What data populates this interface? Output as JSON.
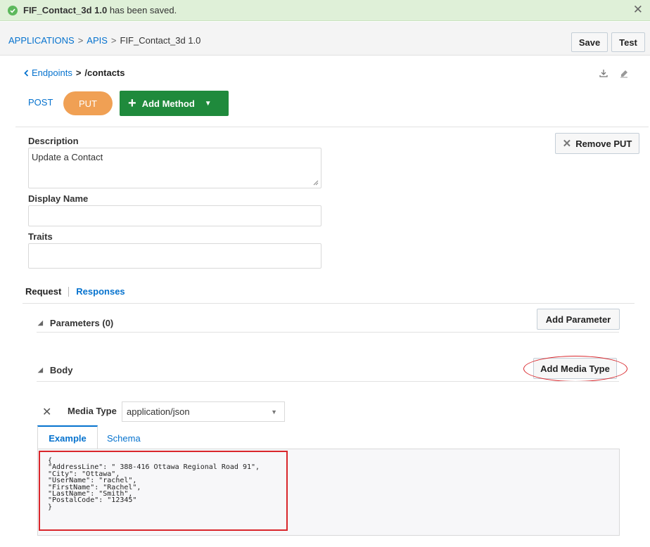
{
  "banner": {
    "name_bold": "FIF_Contact_3d 1.0",
    "message": " has been saved.",
    "close_glyph": "✕"
  },
  "breadcrumb": {
    "items": [
      "APPLICATIONS",
      ">",
      "APIS",
      ">",
      "FIF_Contact_3d  1.0"
    ]
  },
  "toolbar": {
    "save_label": "Save",
    "test_label": "Test"
  },
  "endpoint_nav": {
    "back_label": "Endpoints",
    "separator": ">",
    "path": "/contacts"
  },
  "methods": {
    "post": "POST",
    "put": "PUT",
    "add_method_label": "Add Method",
    "remove_label": "Remove PUT"
  },
  "fields": {
    "description_label": "Description",
    "description_value": "Update a Contact",
    "display_name_label": "Display Name",
    "display_name_value": "",
    "traits_label": "Traits",
    "traits_value": ""
  },
  "subtabs": {
    "request": "Request",
    "responses": "Responses"
  },
  "parameters": {
    "title": "Parameters (0)",
    "add_label": "Add Parameter"
  },
  "body": {
    "title": "Body",
    "add_media_type_label": "Add Media Type",
    "media_type_label": "Media Type",
    "media_type_value": "application/json",
    "tab_example": "Example",
    "tab_schema": "Schema",
    "example_text": "{\n\"AddressLine\": \" 388-416 Ottawa Regional Road 91\",\n\"City\": \"Ottawa\",\n\"UserName\": \"rachel\",\n\"FirstName\": \"Rachel\",\n\"LastName\": \"Smith\",\n\"PostalCode\": \"12345\"\n}"
  },
  "colors": {
    "accent_blue": "#0572ce",
    "put_orange": "#f0a054",
    "add_method_green": "#1f8a3c",
    "success_bg": "#dff0d8",
    "highlight_red": "#d9262b"
  },
  "icons": [
    "check-circle-icon",
    "close-icon",
    "chevron-left-icon",
    "download-icon",
    "edit-icon",
    "plus-icon",
    "caret-down-icon",
    "remove-x-icon",
    "collapse-triangle-icon"
  ]
}
